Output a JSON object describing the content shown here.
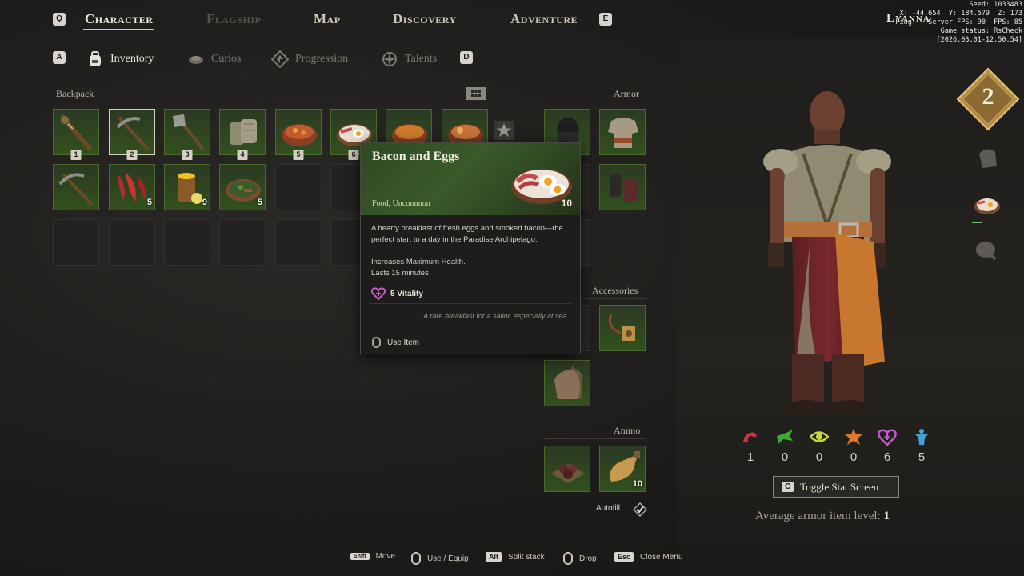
{
  "nav": {
    "left_key": "Q",
    "right_key": "E",
    "tabs": [
      {
        "label": "Character"
      },
      {
        "label": "Flagship"
      },
      {
        "label": "Map"
      },
      {
        "label": "Discovery"
      },
      {
        "label": "Adventure"
      }
    ]
  },
  "subnav": {
    "left_key": "A",
    "right_key": "D",
    "tabs": [
      {
        "label": "Inventory",
        "icon": "backpack-icon"
      },
      {
        "label": "Curios",
        "icon": "curios-icon"
      },
      {
        "label": "Progression",
        "icon": "progression-icon"
      },
      {
        "label": "Talents",
        "icon": "talents-icon"
      }
    ]
  },
  "backpack": {
    "title": "Backpack",
    "hotbar": [
      {
        "num": "1",
        "icon": "spiked-club-icon"
      },
      {
        "num": "2",
        "icon": "pickaxe-icon"
      },
      {
        "num": "3",
        "icon": "axe-icon"
      },
      {
        "num": "4",
        "icon": "bandage-icon"
      },
      {
        "num": "5",
        "icon": "stew-bowl-icon"
      },
      {
        "num": "6",
        "icon": "bacon-eggs-icon"
      }
    ],
    "row2": [
      {
        "icon": "pickaxe-icon",
        "qty": ""
      },
      {
        "icon": "red-fish-icon",
        "qty": "5"
      },
      {
        "icon": "fruit-drink-icon",
        "qty": "9"
      },
      {
        "icon": "herb-dish-icon",
        "qty": "5"
      }
    ]
  },
  "armor": {
    "title": "Armor"
  },
  "accessories": {
    "title": "Accessories"
  },
  "ammo": {
    "title": "Ammo",
    "bolt_qty": "10",
    "autofill_label": "Autofill"
  },
  "tooltip": {
    "title": "Bacon and Eggs",
    "subtitle": "Food, Uncommon",
    "quantity": "10",
    "description_1": "A hearty breakfast of fresh eggs and smoked bacon—the perfect start to a day in the Paradise Archipelago.",
    "description_2": "Increases Maximum Health.",
    "description_3": "Lasts 15 minutes",
    "vitality": "5 Vitality",
    "flavor": "A rare breakfast for a sailor, especially at sea.",
    "use_label": "Use Item"
  },
  "character": {
    "name": "Lyanna",
    "level": "2",
    "stats": [
      {
        "icon": "strength-icon",
        "value": "1",
        "color": "#d6303c"
      },
      {
        "icon": "dexterity-icon",
        "value": "0",
        "color": "#3fa735"
      },
      {
        "icon": "perception-icon",
        "value": "0",
        "color": "#c7d93a"
      },
      {
        "icon": "instinct-icon",
        "value": "0",
        "color": "#e07a28"
      },
      {
        "icon": "vitality-icon",
        "value": "6",
        "color": "#c25ac8"
      },
      {
        "icon": "spirit-icon",
        "value": "5",
        "color": "#4aa0d8"
      }
    ],
    "toggle_key": "C",
    "toggle_label": "Toggle Stat Screen",
    "avg_label": "Average armor item level:",
    "avg_value": "1"
  },
  "bottom": [
    {
      "key": "Shift",
      "label": "Move"
    },
    {
      "key": "mouse",
      "label": "Use / Equip"
    },
    {
      "key": "Alt",
      "label": "Split stack"
    },
    {
      "key": "mouse",
      "label": "Drop"
    },
    {
      "key": "Esc",
      "label": "Close Menu"
    }
  ],
  "debug": {
    "line1": "Seed: 1033483",
    "line2": "X: -44.654  Y: 184.579  Z: 173",
    "line3": "Ping: - Server FPS: 90  FPS: 85",
    "line4": "Game status: RsCheck",
    "line5": "[2026.03.01-12.50.54]"
  }
}
